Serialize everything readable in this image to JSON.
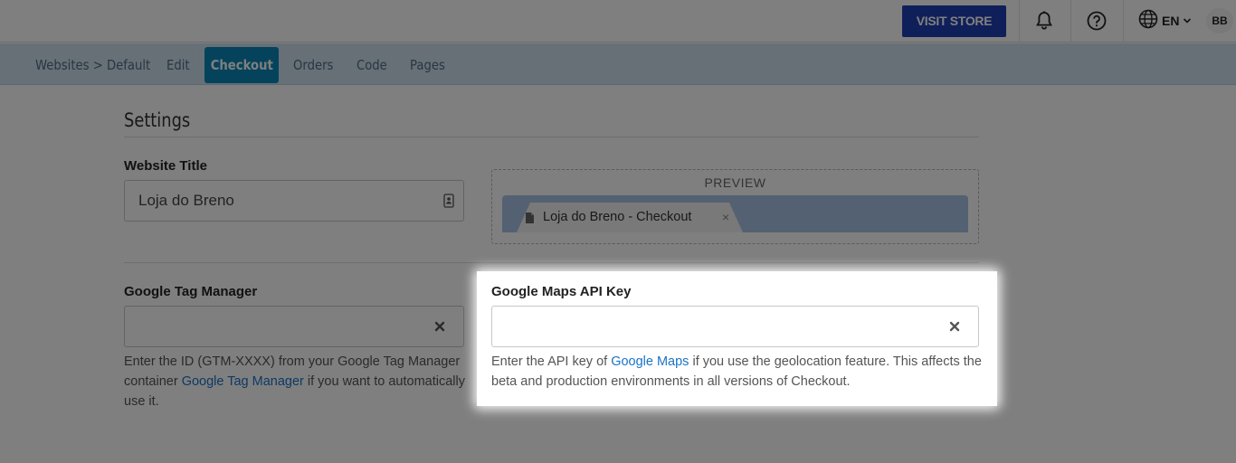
{
  "topbar": {
    "visit_store_label": "VISIT STORE",
    "language_code": "EN",
    "user_initials": "BB",
    "icons": [
      "bell-icon",
      "help-circle-icon",
      "globe-icon",
      "chevron-down-icon"
    ]
  },
  "nav": {
    "items": [
      {
        "label": "Websites > Default"
      },
      {
        "label": "Edit"
      },
      {
        "label": "Checkout"
      },
      {
        "label": "Orders"
      },
      {
        "label": "Code"
      },
      {
        "label": "Pages"
      }
    ],
    "active": "Checkout"
  },
  "settings": {
    "title": "Settings",
    "website_title": {
      "label": "Website Title",
      "value": "Loja do Breno"
    },
    "preview": {
      "label": "PREVIEW",
      "tab_title": "Loja do Breno - Checkout",
      "close_glyph": "×"
    },
    "gtm": {
      "label": "Google Tag Manager",
      "value": "",
      "help_before": "Enter the ID (GTM-XXXX) from your Google Tag Manager container ",
      "help_link": "Google Tag Manager",
      "help_after": " if you want to automatically use it."
    },
    "maps": {
      "label": "Google Maps API Key",
      "value": "",
      "help_before": "Enter the API key of ",
      "help_link": "Google Maps",
      "help_after": " if you use the geolocation feature. This affects the beta and production environments in all versions of Checkout."
    }
  },
  "colors": {
    "accent": "#1e3fb5",
    "nav_active": "#0a87b8",
    "nav_bg": "#cfe1ec",
    "link": "#1a73c9"
  }
}
